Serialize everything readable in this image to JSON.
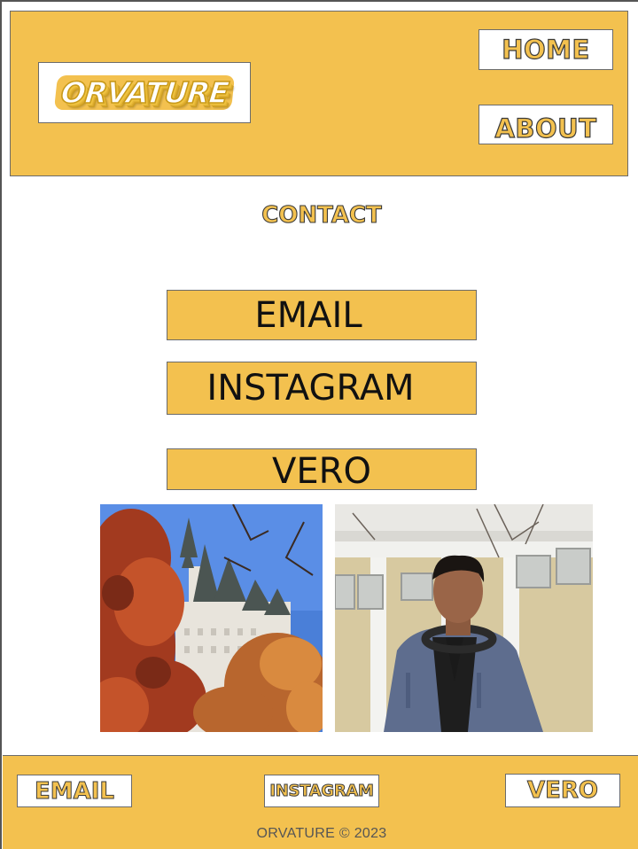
{
  "header": {
    "logo_text": "ORVATURE",
    "nav": {
      "home_label": "HOME",
      "about_label": "ABOUT"
    }
  },
  "main": {
    "title": "CONTACT",
    "buttons": {
      "email_label": "EMAIL",
      "instagram_label": "INSTAGRAM",
      "vero_label": "VERO"
    },
    "photos": [
      {
        "icon": "castle-autumn-photo"
      },
      {
        "icon": "person-headphones-photo"
      }
    ]
  },
  "footer": {
    "email_label": "EMAIL",
    "instagram_label": "INSTAGRAM",
    "vero_label": "VERO",
    "copyright": "ORVATURE © 2023"
  },
  "colors": {
    "accent": "#f3c14f",
    "border": "#6b6b6b",
    "button_text": "#111111"
  }
}
